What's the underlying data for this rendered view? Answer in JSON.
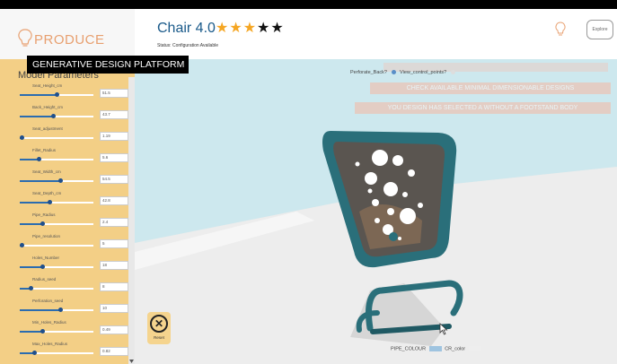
{
  "app": {
    "logo_text": "PRODUCE",
    "banner": "GENERATIVE DESIGN PLATFORM"
  },
  "header": {
    "title": "Chair 4.0",
    "rating": 5,
    "status": "Status: Configuration Available",
    "faint_text": "",
    "button_label": "Explore"
  },
  "sidebar": {
    "title": "Model Parameters",
    "params": [
      {
        "label": "Seat_Height_cm",
        "value": "51.5",
        "level": 0.5
      },
      {
        "label": "Back_Height_cm",
        "value": "43.7",
        "level": 0.45
      },
      {
        "label": "Seat_adjustment",
        "value": "1.19",
        "level": 0.02
      },
      {
        "label": "Fillet_Radius",
        "value": "5.6",
        "level": 0.25
      },
      {
        "label": "Seat_Width_cm",
        "value": "54.5",
        "level": 0.55
      },
      {
        "label": "Seat_Depth_cm",
        "value": "42.8",
        "level": 0.4
      },
      {
        "label": "Pipe_Radius",
        "value": "2.4",
        "level": 0.3
      },
      {
        "label": "Pipe_resolution",
        "value": "5",
        "level": 0.03
      },
      {
        "label": "Holes_Number",
        "value": "18",
        "level": 0.3
      },
      {
        "label": "Radius_seed",
        "value": "8",
        "level": 0.15
      },
      {
        "label": "Perforation_seed",
        "value": "10",
        "level": 0.55
      },
      {
        "label": "Min_Holes_Radius",
        "value": "0.49",
        "level": 0.3
      },
      {
        "label": "Max_Holes_Radius",
        "value": "0.82",
        "level": 0.2
      }
    ]
  },
  "viewport": {
    "perforate_back_label": "Perforate_Back?",
    "view_control_points_label": "View_control_points?",
    "warning_1": "CHECK AVAILABLE MINIMAL DIMENSIONABLE DESIGNS",
    "warning_2": "YOU DESIGN HAS SELECTED A WITHOUT A FOOTSTAND BODY",
    "reset_label": "Reset",
    "pipe_colour_label": "PIPE_COLOUR",
    "cr_colour_label": "CR_color"
  },
  "colors": {
    "sidebar_bg": "#f3cf86",
    "accent_blue": "#2b6cb0",
    "chair_teal": "#2a6f7a",
    "warning_pink": "#f6b7a2",
    "star_gold": "#f5a623"
  }
}
